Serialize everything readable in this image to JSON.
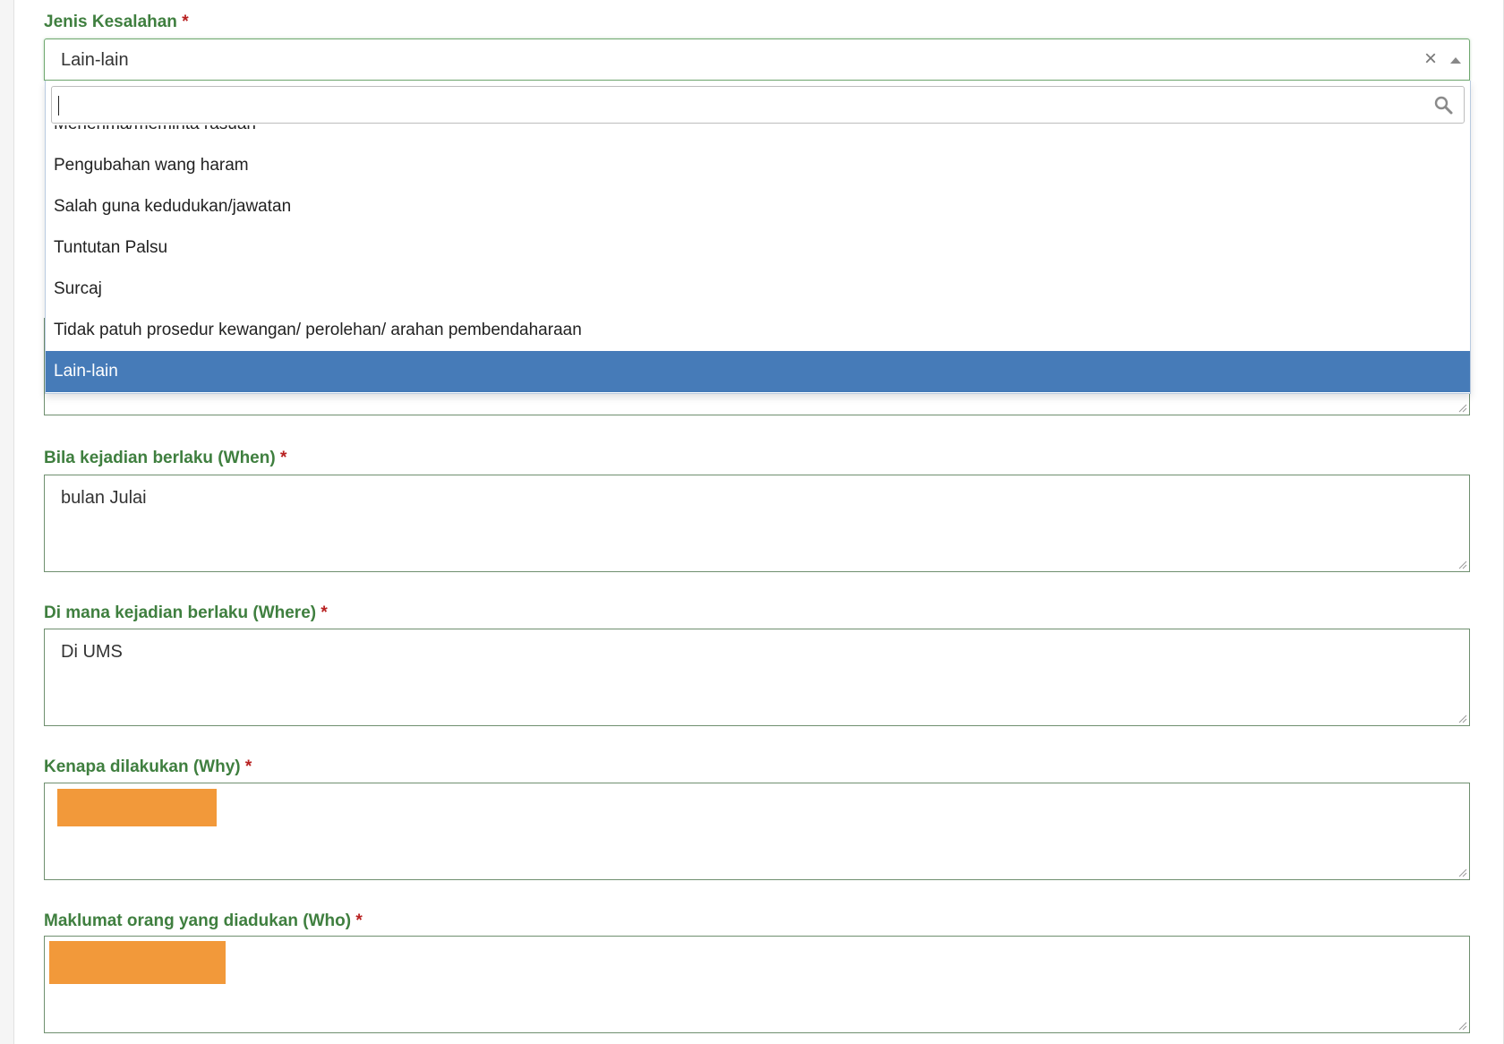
{
  "fields": {
    "jenis": {
      "label": "Jenis Kesalahan",
      "required_mark": "*",
      "selected_value": "Lain-lain",
      "clear_symbol": "×"
    },
    "dropdown": {
      "search_value": "",
      "options": [
        "Menerima/meminta rasuah",
        "Pengubahan wang haram",
        "Salah guna kedudukan/jawatan",
        "Tuntutan Palsu",
        "Surcaj",
        "Tidak patuh prosedur kewangan/ perolehan/ arahan pembendaharaan",
        "Lain-lain"
      ],
      "selected_option": "Lain-lain"
    },
    "when": {
      "label": "Bila kejadian berlaku (When)",
      "required_mark": "*",
      "value": "bulan Julai"
    },
    "where": {
      "label": "Di mana kejadian berlaku (Where)",
      "required_mark": "*",
      "value": "Di UMS"
    },
    "why": {
      "label": "Kenapa dilakukan (Why)",
      "required_mark": "*",
      "value": ""
    },
    "who": {
      "label": "Maklumat orang yang diadukan (Who)",
      "required_mark": "*",
      "value": ""
    }
  },
  "colors": {
    "label_green": "#3f7f3f",
    "required_red": "#b82020",
    "highlight_blue": "#467bb8",
    "redaction_orange": "#f2993a"
  }
}
